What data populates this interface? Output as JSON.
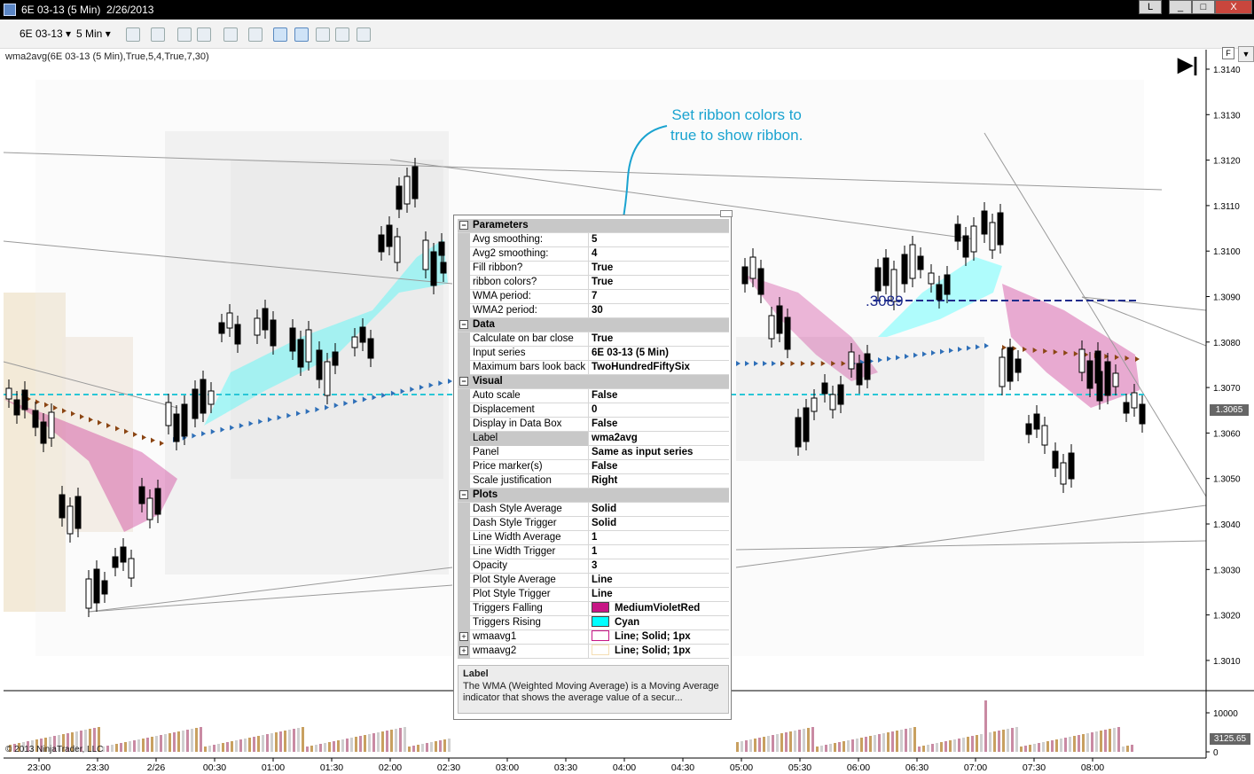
{
  "window": {
    "title": "6E 03-13 (5 Min)  2/26/2013",
    "buttons": [
      "L",
      "_",
      "□",
      "X"
    ]
  },
  "toolbar": {
    "instrument": "6E 03-13",
    "interval": "5 Min",
    "icons": [
      "bar-type-icon",
      "pencil-draw-icon",
      "zoom-in-icon",
      "zoom-out-icon",
      "crosshair-icon",
      "magnifier-icon",
      "data-box-icon",
      "chart-style-icon",
      "indicators-icon",
      "strategies-icon",
      "properties-icon"
    ]
  },
  "chart": {
    "indicator_label": "wma2avg(6E 03-13 (5 Min),True,5,4,True,7,30)",
    "copyright": "© 2013 NinjaTrader, LLC",
    "f_label": "F",
    "price_marker": "1.3065",
    "volume_marker": "3125.65",
    "annotation": "Set ribbon colors to\ntrue to show ribbon.",
    "level_label": ".3089",
    "price_ticks": [
      "1.3140",
      "1.3130",
      "1.3120",
      "1.3110",
      "1.3100",
      "1.3090",
      "1.3080",
      "1.3070",
      "1.3060",
      "1.3050",
      "1.3040",
      "1.3030",
      "1.3020",
      "1.3010"
    ],
    "volume_ticks": [
      "10000",
      "0"
    ],
    "time_ticks": [
      "23:00",
      "23:30",
      "2/26",
      "00:30",
      "01:00",
      "01:30",
      "02:00",
      "02:30",
      "03:00",
      "03:30",
      "04:00",
      "04:30",
      "05:00",
      "05:30",
      "06:00",
      "06:30",
      "07:00",
      "07:30",
      "08:00"
    ]
  },
  "colors": {
    "accent": "#1aa3d0",
    "falling": "#c71585",
    "rising": "#00ffff",
    "level_line": "#1f2c8c",
    "wmaavg2_swatch": "#f5deb3"
  },
  "properties": {
    "sections": [
      {
        "name": "Parameters",
        "rows": [
          {
            "name": "Avg smoothing:",
            "value": "5"
          },
          {
            "name": "Avg2 smoothing:",
            "value": "4"
          },
          {
            "name": "Fill ribbon?",
            "value": "True"
          },
          {
            "name": "ribbon colors?",
            "value": "True"
          },
          {
            "name": "WMA period:",
            "value": "7"
          },
          {
            "name": "WMA2 period:",
            "value": "30"
          }
        ]
      },
      {
        "name": "Data",
        "rows": [
          {
            "name": "Calculate on bar close",
            "value": "True"
          },
          {
            "name": "Input series",
            "value": "6E 03-13 (5 Min)"
          },
          {
            "name": "Maximum bars look back",
            "value": "TwoHundredFiftySix"
          }
        ]
      },
      {
        "name": "Visual",
        "rows": [
          {
            "name": "Auto scale",
            "value": "False"
          },
          {
            "name": "Displacement",
            "value": "0"
          },
          {
            "name": "Display in Data Box",
            "value": "False"
          },
          {
            "name": "Label",
            "value": "wma2avg"
          },
          {
            "name": "Panel",
            "value": "Same as input series"
          },
          {
            "name": "Price marker(s)",
            "value": "False"
          },
          {
            "name": "Scale justification",
            "value": "Right"
          }
        ]
      },
      {
        "name": "Plots",
        "rows": [
          {
            "name": "Dash Style Average",
            "value": "Solid"
          },
          {
            "name": "Dash Style Trigger",
            "value": "Solid"
          },
          {
            "name": "Line Width Average",
            "value": "1"
          },
          {
            "name": "Line Width Trigger",
            "value": "1"
          },
          {
            "name": "Opacity",
            "value": "3"
          },
          {
            "name": "Plot Style Average",
            "value": "Line"
          },
          {
            "name": "Plot Style Trigger",
            "value": "Line"
          },
          {
            "name": "Triggers Falling",
            "value": "MediumVioletRed"
          },
          {
            "name": "Triggers Rising",
            "value": "Cyan"
          },
          {
            "name": "wmaavg1",
            "value": "Line; Solid; 1px"
          },
          {
            "name": "wmaavg2",
            "value": "Line; Solid; 1px"
          }
        ]
      }
    ],
    "description_title": "Label",
    "description_text": "The WMA (Weighted Moving Average) is a Moving Average indicator that shows the average value of a secur..."
  }
}
